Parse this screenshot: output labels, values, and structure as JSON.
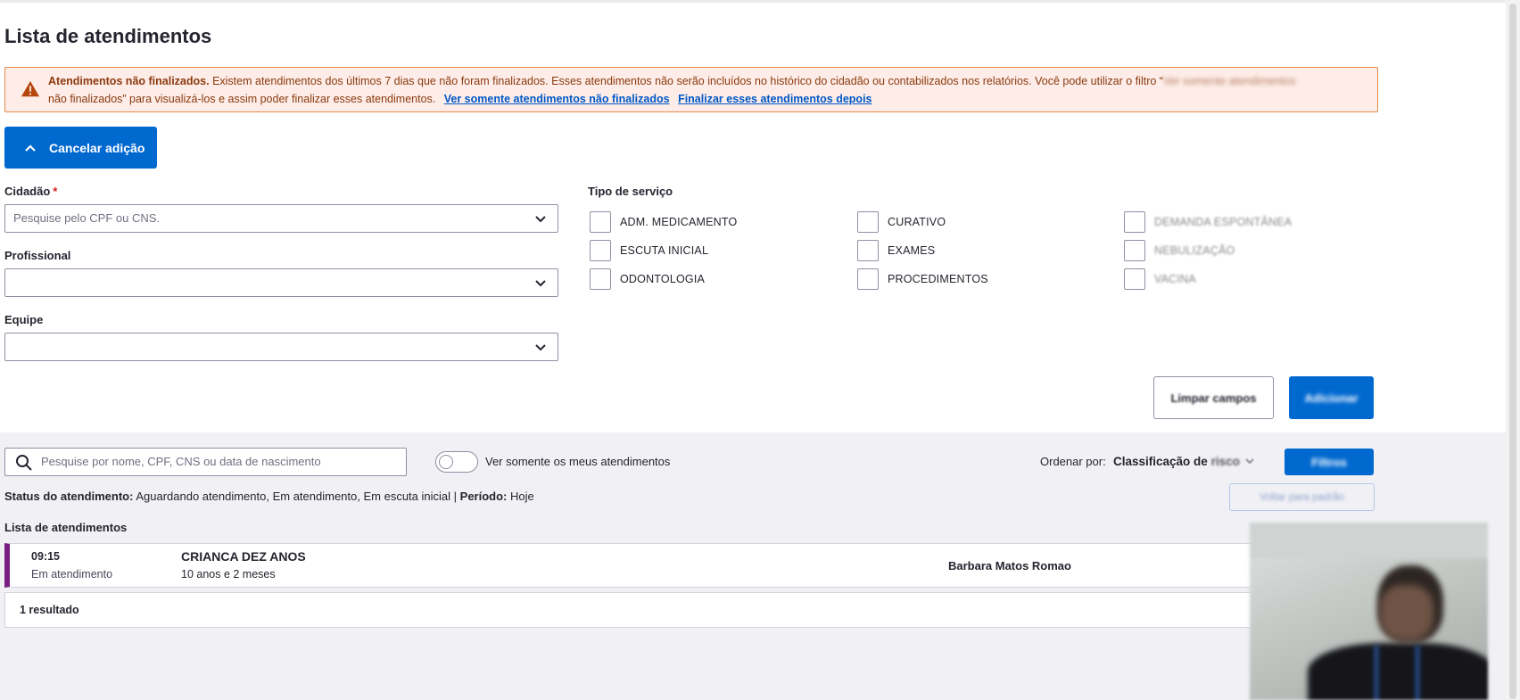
{
  "page": {
    "title": "Lista de atendimentos"
  },
  "alert": {
    "strong": "Atendimentos não finalizados.",
    "text_main": "Existem atendimentos dos últimos 7 dias que não foram finalizados. Esses atendimentos não serão incluídos no histórico do cidadão ou contabilizados nos relatórios. Você pode utilizar o filtro “",
    "text_blurred": "Ver somente atendimentos",
    "text_cont": "não finalizados” para visualizá-los e assim poder finalizar esses atendimentos.",
    "link_view": "Ver somente atendimentos não finalizados",
    "link_later": "Finalizar esses atendimentos depois",
    "icon": "warning-icon",
    "color_bg": "#fdece7",
    "color_border": "#e48a4a"
  },
  "form": {
    "cancel_button": "Cancelar adição",
    "citizen_label": "Cidadão",
    "required_mark": "*",
    "citizen_placeholder": "Pesquise pelo CPF ou CNS.",
    "professional_label": "Profissional",
    "professional_value": "",
    "team_label": "Equipe",
    "team_value": "",
    "service_type_label": "Tipo de serviço",
    "services": [
      "ADM. MEDICAMENTO",
      "CURATIVO",
      "DEMANDA ESPONTÂNEA",
      "ESCUTA INICIAL",
      "EXAMES",
      "NEBULIZAÇÃO",
      "ODONTOLOGIA",
      "PROCEDIMENTOS",
      "VACINA"
    ],
    "clear_button": "Limpar campos",
    "add_button": "Adicionar"
  },
  "list": {
    "search_placeholder": "Pesquise por nome, CPF, CNS ou data de nascimento",
    "toggle_label": "Ver somente os meus atendimentos",
    "order_label": "Ordenar por:",
    "order_value_a": "Classificação de",
    "order_value_b": "risco",
    "filter_button": "Filtros",
    "status_label": "Status do atendimento:",
    "status_value": "Aguardando atendimento, Em atendimento, Em escuta inicial",
    "separator": "|",
    "period_label": "Período:",
    "period_value": "Hoje",
    "back_button": "Voltar para padrão",
    "title": "Lista de atendimentos",
    "rows": [
      {
        "time": "09:15",
        "state": "Em atendimento",
        "name": "CRIANCA DEZ ANOS",
        "age": "10 anos e 2 meses",
        "professional": "Barbara Matos Romao",
        "status_color": "#7a1e82"
      }
    ],
    "result_count": "1 resultado"
  },
  "colors": {
    "primary": "#0069d0",
    "text": "#24252e",
    "list_bg": "#f0f0f5"
  }
}
